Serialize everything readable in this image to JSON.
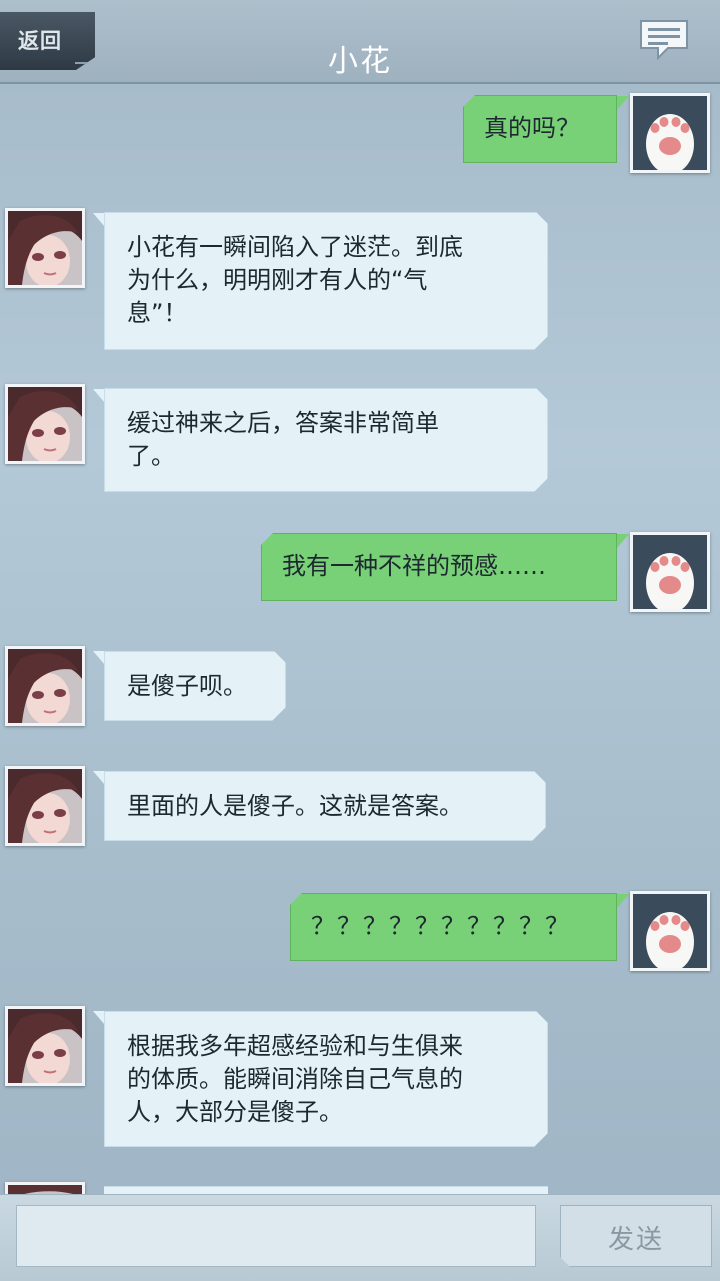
{
  "header": {
    "back_label": "返回",
    "title": "小花",
    "chat_icon": "chat-bubble-icon"
  },
  "messages": [
    {
      "sender": "me",
      "avatar": "cat-paw-avatar",
      "text": "真的吗？"
    },
    {
      "sender": "xiaohua",
      "avatar": "girl-avatar",
      "text": "小花有一瞬间陷入了迷茫。到底\n为什么，明明刚才有人的“气\n息”！"
    },
    {
      "sender": "xiaohua",
      "avatar": "girl-avatar",
      "text": "缓过神来之后，答案非常简单\n了。"
    },
    {
      "sender": "me",
      "avatar": "cat-paw-avatar",
      "text": "我有一种不祥的预感……"
    },
    {
      "sender": "xiaohua",
      "avatar": "girl-avatar",
      "text": "是傻子呗。"
    },
    {
      "sender": "xiaohua",
      "avatar": "girl-avatar",
      "text": "里面的人是傻子。这就是答案。"
    },
    {
      "sender": "me",
      "avatar": "cat-paw-avatar",
      "text": "？？？？？？？？？？"
    },
    {
      "sender": "xiaohua",
      "avatar": "girl-avatar",
      "text": "根据我多年超感经验和与生俱来\n的体质。能瞬间消除自己气息的\n人，大部分是傻子。"
    }
  ],
  "input": {
    "value": "",
    "send_label": "发送"
  },
  "colors": {
    "my_bubble": "#78d077",
    "their_bubble": "#e4f1f7",
    "background": "#b4c9d8"
  }
}
